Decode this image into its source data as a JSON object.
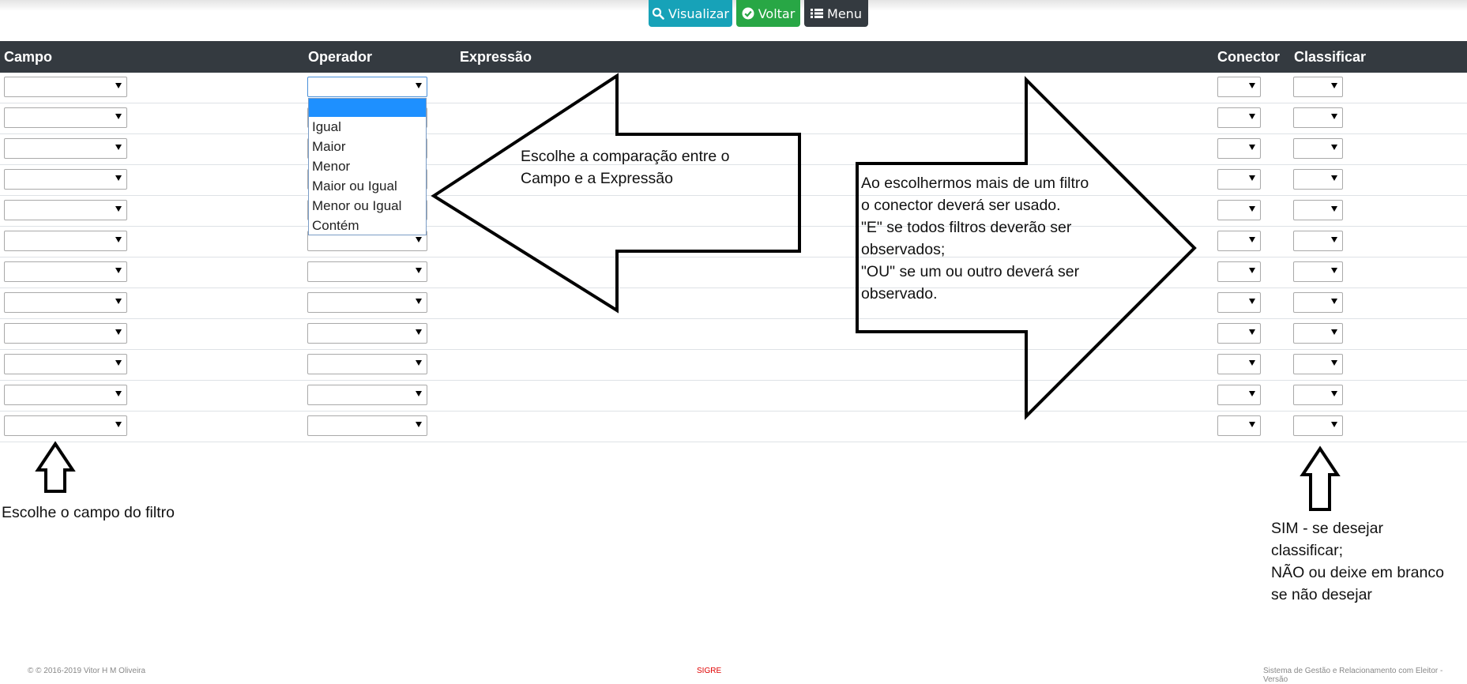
{
  "toolbar": {
    "visualizar": "Visualizar",
    "voltar": "Voltar",
    "menu": "Menu",
    "colors": {
      "visualizar": "#17a2b8",
      "voltar": "#28a745",
      "menu": "#343a40"
    }
  },
  "table": {
    "headers": {
      "campo": "Campo",
      "operador": "Operador",
      "expressao": "Expressão",
      "conector": "Conector",
      "classificar": "Classificar"
    },
    "row_count": 12
  },
  "operator_dropdown": {
    "options": [
      "",
      "Igual",
      "Maior",
      "Menor",
      "Maior ou Igual",
      "Menor ou Igual",
      "Contém"
    ],
    "highlighted": ""
  },
  "annotations": {
    "operador_line1": "Escolhe a comparação entre o",
    "operador_line2": "Campo e a Expressão",
    "conector_l1": "Ao escolhermos mais de um filtro",
    "conector_l2": "o conector deverá ser usado.",
    "conector_l3": "\"E\" se todos filtros deverão ser",
    "conector_l4": "observados;",
    "conector_l5": "\"OU\" se um ou outro deverá ser",
    "conector_l6": "observado.",
    "campo": "Escolhe o campo do filtro",
    "classificar_l1": "SIM - se desejar",
    "classificar_l2": "classificar;",
    "classificar_l3": "NÃO ou deixe em branco",
    "classificar_l4": "se não desejar"
  },
  "footer": {
    "copyright": "© © 2016-2019 Vitor H M Oliveira",
    "app": "SIGRE",
    "system": "Sistema de Gestão e Relacionamento com Eleitor - Versão"
  }
}
